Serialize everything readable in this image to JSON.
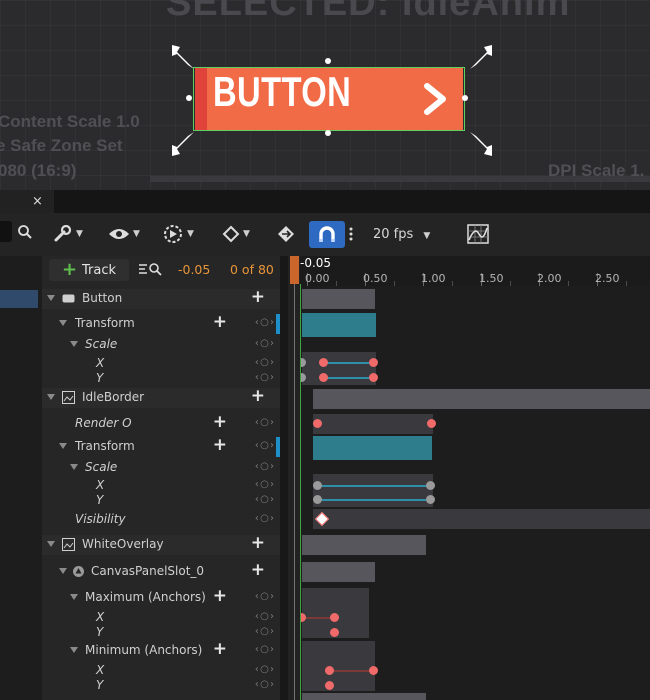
{
  "viewport": {
    "title": "SELECTED: IdleAnim",
    "content_scale": "Content Scale 1.0",
    "safe_zone": "e Safe Zone Set",
    "resolution": "080 (16:9)",
    "dpi_scale": "DPI Scale 1.",
    "widget_label": "BUTTON",
    "widget_color": "#f26b47",
    "selection_color": "#5fd05f"
  },
  "tab": {
    "close_glyph": "×"
  },
  "toolbar": {
    "fps": "20 fps"
  },
  "header": {
    "track_label": "Track",
    "current_time": "-0.05",
    "frame_count": "0 of 80",
    "playhead_label": "-0.05"
  },
  "ruler": {
    "ticks": [
      "0.00",
      "0.50",
      "1.00",
      "1.50",
      "2.00",
      "2.50"
    ]
  },
  "tracks": [
    {
      "label": "Button"
    },
    {
      "label": "Transform"
    },
    {
      "label": "Scale"
    },
    {
      "label": "X"
    },
    {
      "label": "Y"
    },
    {
      "label": "IdleBorder"
    },
    {
      "label": "Render O"
    },
    {
      "label": "Transform"
    },
    {
      "label": "Scale"
    },
    {
      "label": "X"
    },
    {
      "label": "Y"
    },
    {
      "label": "Visibility"
    },
    {
      "label": "WhiteOverlay"
    },
    {
      "label": "CanvasPanelSlot_0"
    },
    {
      "label": "Maximum (Anchors)"
    },
    {
      "label": "X"
    },
    {
      "label": "Y"
    },
    {
      "label": "Minimum (Anchors)"
    },
    {
      "label": "X"
    },
    {
      "label": "Y"
    }
  ],
  "colors": {
    "accent": "#2e6ac2",
    "time": "#e8953a",
    "key": "#f06a6a",
    "track_teal": "#2e7d8c"
  }
}
